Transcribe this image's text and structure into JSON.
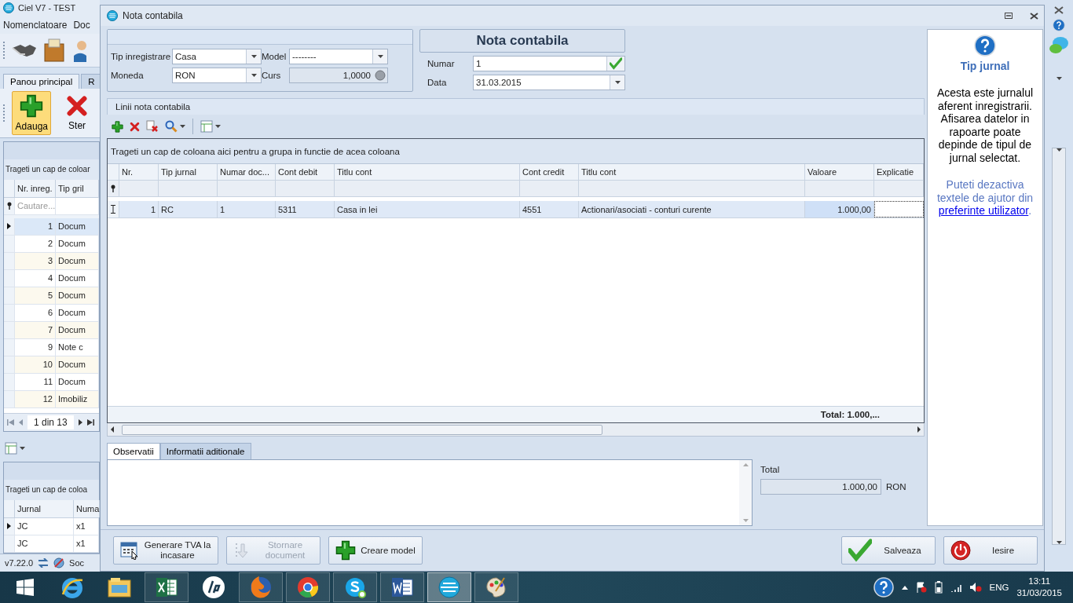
{
  "background_app": {
    "title": "Ciel V7 - TEST",
    "menu": [
      "Nomenclatoare",
      "Doc"
    ],
    "tabs": [
      {
        "label": "Panou principal",
        "selected": true
      },
      {
        "label": "R",
        "selected": false
      }
    ],
    "ribbon": [
      {
        "label": "Adauga",
        "selected": true,
        "kind": "add"
      },
      {
        "label": "Ster",
        "selected": false,
        "kind": "delete"
      }
    ],
    "grid": {
      "group_hint": "Trageti un cap de coloar",
      "columns": [
        "Nr. inreg.",
        "Tip gril"
      ],
      "filter_placeholder": "Cautare...",
      "rows": [
        {
          "number": "1",
          "type": "Docum",
          "selected": true
        },
        {
          "number": "2",
          "type": "Docum",
          "selected": false
        },
        {
          "number": "3",
          "type": "Docum",
          "selected": false
        },
        {
          "number": "4",
          "type": "Docum",
          "selected": false
        },
        {
          "number": "5",
          "type": "Docum",
          "selected": false
        },
        {
          "number": "6",
          "type": "Docum",
          "selected": false
        },
        {
          "number": "7",
          "type": "Docum",
          "selected": false
        },
        {
          "number": "9",
          "type": "Note c",
          "selected": false
        },
        {
          "number": "10",
          "type": "Docum",
          "selected": false
        },
        {
          "number": "11",
          "type": "Docum",
          "selected": false
        },
        {
          "number": "12",
          "type": "Imobiliz",
          "selected": false
        }
      ],
      "pager": "1 din 13"
    },
    "lower_grid": {
      "group_hint": "Trageti un cap de coloa",
      "columns": [
        "Jurnal",
        "Numa"
      ],
      "rows": [
        {
          "journal": "JC",
          "number": "x1",
          "selected": true
        },
        {
          "journal": "JC",
          "number": "x1",
          "selected": false
        }
      ]
    },
    "status_bar": {
      "version": "v7.22.0",
      "text": "Soc"
    }
  },
  "dialog": {
    "title": "Nota contabila",
    "heading": "Nota contabila",
    "fields": [
      {
        "label": "Tip inregistrare",
        "value": "Casa",
        "kind": "dropdown"
      },
      {
        "label": "Model",
        "value": "--------",
        "kind": "dropdown"
      },
      {
        "label": "Moneda",
        "value": "RON",
        "kind": "dropdown"
      },
      {
        "label": "Curs",
        "value": "1,0000",
        "kind": "readonly"
      }
    ],
    "number": {
      "label": "Numar",
      "value": "1"
    },
    "date": {
      "label": "Data",
      "value": "31.03.2015"
    },
    "lines": {
      "title": "Linii nota contabila",
      "group_hint": "Trageti un cap de coloana aici pentru a grupa in functie de acea coloana",
      "columns": [
        "Nr.",
        "Tip jurnal",
        "Numar doc...",
        "Cont debit",
        "Titlu cont",
        "Cont credit",
        "Titlu cont",
        "Valoare",
        "Explicatie"
      ],
      "rows": [
        {
          "cells": [
            "1",
            "RC",
            "1",
            "5311",
            "Casa in lei",
            "4551",
            "Actionari/asociati - conturi curente",
            "1.000,00"
          ],
          "selected": true
        }
      ],
      "total": "Total: 1.000,..."
    },
    "tabs": [
      {
        "label": "Observatii",
        "selected": true
      },
      {
        "label": "Informatii aditionale",
        "selected": false
      }
    ],
    "total": {
      "label": "Total",
      "value": "1.000,00",
      "currency": "RON"
    },
    "buttons": [
      {
        "label": "Generare TVA la incasare",
        "kind": "vat",
        "disabled": false
      },
      {
        "label": "Stornare document",
        "kind": "reverse",
        "disabled": true
      },
      {
        "label": "Creare model",
        "kind": "add",
        "disabled": false
      },
      {
        "label": "Salveaza",
        "kind": "save",
        "disabled": false
      },
      {
        "label": "Iesire",
        "kind": "exit",
        "disabled": false
      }
    ],
    "help": {
      "title": "Tip jurnal",
      "body": "Acesta este jurnalul aferent inregistrarii. Afisarea datelor in rapoarte poate depinde de tipul de jurnal selectat.",
      "hint": "Puteti dezactiva textele de ajutor din",
      "link": "preferinte utilizator",
      "after": "."
    }
  },
  "taskbar": {
    "apps": [
      {
        "kind": "browser-e",
        "running": false,
        "selected": false
      },
      {
        "kind": "folder",
        "running": false,
        "selected": false
      },
      {
        "kind": "sheet",
        "running": true,
        "selected": false
      },
      {
        "kind": "hp",
        "running": false,
        "selected": false
      },
      {
        "kind": "fox",
        "running": true,
        "selected": false
      },
      {
        "kind": "chrome",
        "running": true,
        "selected": false
      },
      {
        "kind": "skype",
        "running": true,
        "selected": false
      },
      {
        "kind": "doc",
        "running": true,
        "selected": false
      },
      {
        "kind": "ciel",
        "running": true,
        "selected": true
      },
      {
        "kind": "paint",
        "running": true,
        "selected": false
      }
    ],
    "language": "ENG",
    "time": "13:11",
    "date": "31/03/2015"
  }
}
